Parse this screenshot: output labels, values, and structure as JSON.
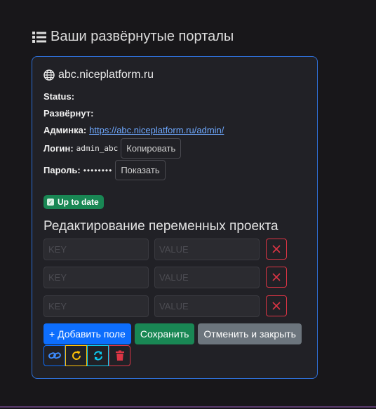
{
  "page": {
    "title": "Ваши развёрнутые порталы",
    "title_icon": "list-icon"
  },
  "portal": {
    "host": "abc.niceplatform.ru",
    "host_icon": "globe-icon",
    "status_label": "Status:",
    "deployed_label": "Развёрнут:",
    "admin_label": "Админка:",
    "admin_url": "https://abc.niceplatform.ru/admin/",
    "login_label": "Логин:",
    "login_value": "admin_abc",
    "copy_button": "Копировать",
    "password_label": "Пароль:",
    "password_mask": "••••••••",
    "show_button": "Показать",
    "badge": "Up to date",
    "badge_color": "#198754"
  },
  "editor": {
    "title": "Редактирование переменных проекта",
    "rows": [
      {
        "key_placeholder": "KEY",
        "value_placeholder": "VALUE"
      },
      {
        "key_placeholder": "KEY",
        "value_placeholder": "VALUE"
      },
      {
        "key_placeholder": "KEY",
        "value_placeholder": "VALUE"
      }
    ],
    "add_button": "+ Добавить поле",
    "save_button": "Сохранить",
    "cancel_button": "Отменить и закрыть"
  },
  "icon_buttons": [
    {
      "icon": "link-icon",
      "color": "#0d6efd"
    },
    {
      "icon": "redo-icon",
      "color": "#ffc107"
    },
    {
      "icon": "sync-icon",
      "color": "#0dcaf0"
    },
    {
      "icon": "trash-icon",
      "color": "#dc3545"
    }
  ],
  "colors": {
    "accent": "#2f6fd6",
    "danger": "#dc3545",
    "link": "#6ea8fe"
  }
}
